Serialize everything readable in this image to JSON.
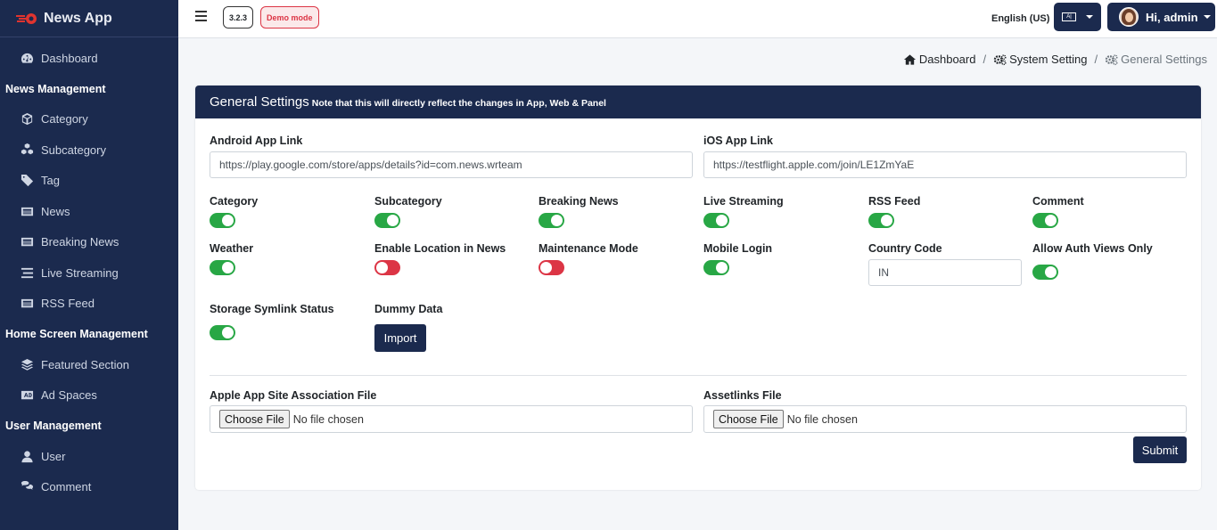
{
  "app": {
    "name": "News App"
  },
  "sidebar": {
    "dashboard": "Dashboard",
    "sections": [
      {
        "header": "News Management",
        "items": [
          "Category",
          "Subcategory",
          "Tag",
          "News",
          "Breaking News",
          "Live Streaming",
          "RSS Feed"
        ]
      },
      {
        "header": "Home Screen Management",
        "items": [
          "Featured Section",
          "Ad Spaces"
        ]
      },
      {
        "header": "User Management",
        "items": [
          "User",
          "Comment"
        ]
      }
    ]
  },
  "topbar": {
    "version": "3.2.3",
    "demo": "Demo mode",
    "language": "English (US)",
    "user_greeting": "Hi, admin"
  },
  "breadcrumb": {
    "home": "Dashboard",
    "parent": "System Setting",
    "current": "General Settings"
  },
  "card": {
    "title": "General Settings",
    "note": "Note that this will directly reflect the changes in App, Web & Panel"
  },
  "fields": {
    "android_label": "Android App Link",
    "android_value": "https://play.google.com/store/apps/details?id=com.news.wrteam",
    "ios_label": "iOS App Link",
    "ios_value": "https://testflight.apple.com/join/LE1ZmYaE"
  },
  "toggles": {
    "category": {
      "label": "Category",
      "on": true
    },
    "subcategory": {
      "label": "Subcategory",
      "on": true
    },
    "breaking_news": {
      "label": "Breaking News",
      "on": true
    },
    "live_streaming": {
      "label": "Live Streaming",
      "on": true
    },
    "rss_feed": {
      "label": "RSS Feed",
      "on": true
    },
    "comment": {
      "label": "Comment",
      "on": true
    },
    "weather": {
      "label": "Weather",
      "on": true
    },
    "location": {
      "label": "Enable Location in News",
      "on": false
    },
    "maintenance": {
      "label": "Maintenance Mode",
      "on": false
    },
    "mobile_login": {
      "label": "Mobile Login",
      "on": true
    },
    "auth_views": {
      "label": "Allow Auth Views Only",
      "on": true
    },
    "symlink": {
      "label": "Storage Symlink Status",
      "on": true
    }
  },
  "country_code": {
    "label": "Country Code",
    "value": "IN"
  },
  "dummy_data": {
    "label": "Dummy Data",
    "button": "Import"
  },
  "files": {
    "apple_label": "Apple App Site Association File",
    "assetlinks_label": "Assetlinks File",
    "choose": "Choose File",
    "none": "No file chosen"
  },
  "submit": "Submit",
  "colors": {
    "primary": "#1b2a4e",
    "on": "#28a745",
    "off": "#dc3545"
  }
}
